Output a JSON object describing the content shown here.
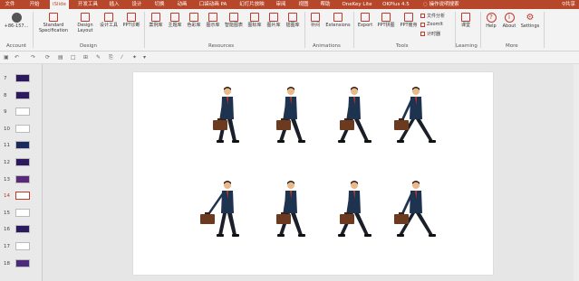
{
  "tabs": [
    {
      "label": "文件"
    },
    {
      "label": "开始"
    },
    {
      "label": "iSlide"
    },
    {
      "label": "开发工具"
    },
    {
      "label": "插入"
    },
    {
      "label": "设计"
    },
    {
      "label": "切换"
    },
    {
      "label": "动画"
    },
    {
      "label": "口袋动画 PA"
    },
    {
      "label": "幻灯片放映"
    },
    {
      "label": "审阅"
    },
    {
      "label": "视图"
    },
    {
      "label": "帮助"
    },
    {
      "label": "OneKey Lite"
    },
    {
      "label": "OKPlus 4.5"
    },
    {
      "label": "操作说明搜索"
    }
  ],
  "share_label": "共享",
  "ribbon": {
    "account": {
      "zoom": "+86-157...",
      "group": "Account"
    },
    "design": {
      "standard": "Standard",
      "specification": "Specification",
      "design": "Design",
      "layout": "Layout",
      "design_tool": "设计工具",
      "ppt_diag": "PPT诊断",
      "group": "Design"
    },
    "resources": {
      "items": [
        {
          "label": "案例库"
        },
        {
          "label": "主题库"
        },
        {
          "label": "色彩库"
        },
        {
          "label": "图示库"
        },
        {
          "label": "智能图表"
        },
        {
          "label": "图标库"
        },
        {
          "label": "图片库"
        },
        {
          "label": "插图库"
        }
      ],
      "group": "Resources"
    },
    "animations": {
      "bujian": "补间",
      "extensions": "Extensions",
      "group": "Animations"
    },
    "tools": {
      "export": "Export",
      "ppt_pin": "PPT拼图",
      "ppt_slim": "PPT瘦身",
      "file_analysis": "文件分析",
      "zoomit": "ZoomIt",
      "timer": "计时器",
      "group": "Tools"
    },
    "learning": {
      "course": "课堂",
      "group": "Learning"
    },
    "more": {
      "help": "Help",
      "about": "About",
      "settings": "Settings",
      "group": "More"
    }
  },
  "slides": [
    {
      "num": "7"
    },
    {
      "num": "8"
    },
    {
      "num": "9"
    },
    {
      "num": "10"
    },
    {
      "num": "11"
    },
    {
      "num": "12"
    },
    {
      "num": "13"
    },
    {
      "num": "14"
    },
    {
      "num": "15"
    },
    {
      "num": "16"
    },
    {
      "num": "17"
    },
    {
      "num": "18"
    }
  ],
  "active_slide": "14",
  "colors": {
    "accent": "#b7472a",
    "suit": "#1e3350",
    "briefcase": "#6b3a1f"
  }
}
